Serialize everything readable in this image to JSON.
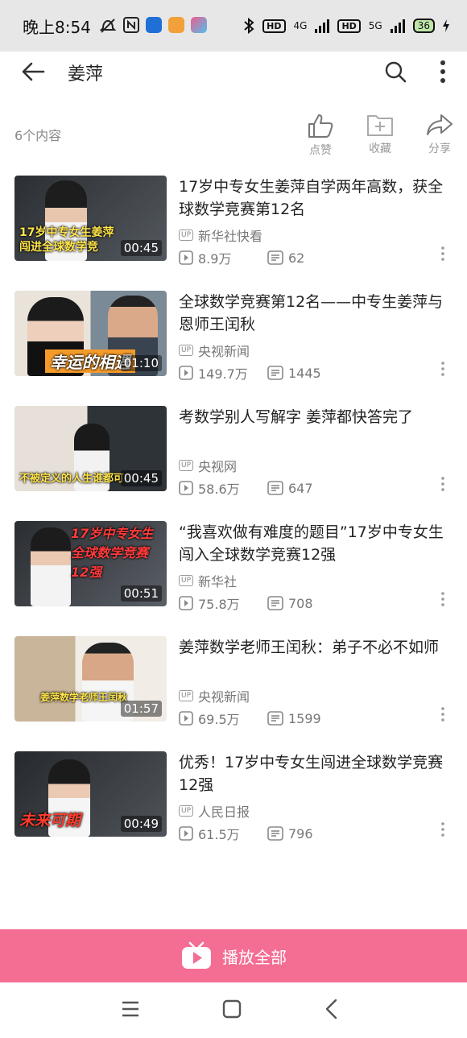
{
  "status_bar": {
    "time": "晚上8:54",
    "hd1": "HD",
    "net1": "4G",
    "hd2": "HD",
    "net2": "5G",
    "battery": "36"
  },
  "header": {
    "title": "姜萍"
  },
  "actions": {
    "count": "6个内容",
    "like": "点赞",
    "favorite": "收藏",
    "share": "分享"
  },
  "videos": [
    {
      "title": "17岁中专女生姜萍自学两年高数，获全球数学竞赛第12名",
      "uploader": "新华社快看",
      "views": "8.9万",
      "comments": "62",
      "duration": "00:45",
      "overlay": "17岁中专女生姜萍闯进全球数学竞",
      "up": "UP"
    },
    {
      "title": "全球数学竞赛第12名——中专生姜萍与恩师王闰秋",
      "uploader": "央视新闻",
      "views": "149.7万",
      "comments": "1445",
      "duration": "01:10",
      "overlay": "幸运的相遇",
      "up": "UP"
    },
    {
      "title": "考数学别人写解字 姜萍都快答完了",
      "uploader": "央视网",
      "views": "58.6万",
      "comments": "647",
      "duration": "00:45",
      "overlay": "不被定义的人生谁都可",
      "up": "UP"
    },
    {
      "title": "“我喜欢做有难度的题目”17岁中专女生闯入全球数学竞赛12强",
      "uploader": "新华社",
      "views": "75.8万",
      "comments": "708",
      "duration": "00:51",
      "overlay": "17岁中专女生 全球数学竞赛12强",
      "up": "UP"
    },
    {
      "title": "姜萍数学老师王闰秋：弟子不必不如师",
      "uploader": "央视新闻",
      "views": "69.5万",
      "comments": "1599",
      "duration": "01:57",
      "overlay": "姜萍数学老师王闰秋",
      "up": "UP"
    },
    {
      "title": "优秀！17岁中专女生闯进全球数学竞赛12强",
      "uploader": "人民日报",
      "views": "61.5万",
      "comments": "796",
      "duration": "00:49",
      "overlay": "未来可期",
      "up": "UP"
    }
  ],
  "play_all": {
    "label": "播放全部"
  },
  "colors": {
    "accent": "#f46d93",
    "status_bg": "#e7e7e7"
  }
}
